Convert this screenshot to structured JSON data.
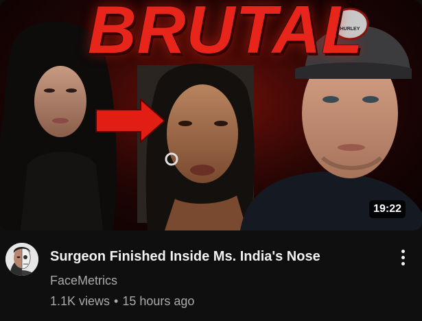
{
  "video": {
    "thumbnail": {
      "overlay_title": "BRUTAL",
      "cap_text": "HURLEY",
      "duration": "19:22",
      "accent_color": "#e8251b"
    },
    "title": "Surgeon Finished Inside Ms. India's Nose",
    "channel": "FaceMetrics",
    "views": "1.1K views",
    "separator": "•",
    "age": "15 hours ago",
    "menu_icon": "more-vertical-icon"
  }
}
